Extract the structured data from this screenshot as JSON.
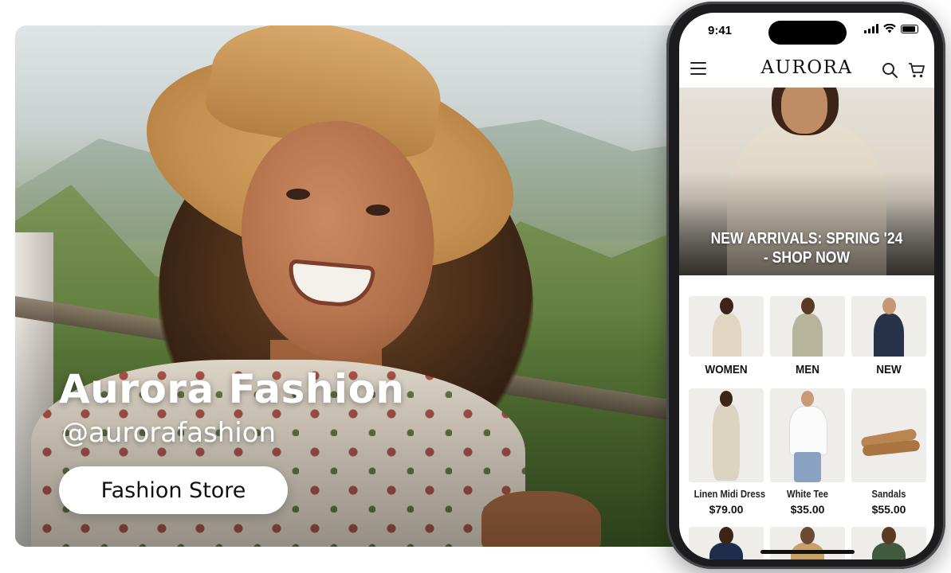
{
  "hero": {
    "title": "Aurora Fashion",
    "handle": "@aurorafashion",
    "category": "Fashion Store"
  },
  "phone": {
    "status_time": "9:41",
    "app_logo": "AURORA",
    "banner_text": "NEW ARRIVALS: SPRING '24 - SHOP NOW",
    "icons": {
      "menu": "hamburger-menu-icon",
      "search": "search-icon",
      "cart": "shopping-cart-icon"
    },
    "categories": [
      {
        "label": "WOMEN"
      },
      {
        "label": "MEN"
      },
      {
        "label": "NEW"
      }
    ],
    "products": [
      {
        "name": "Linen Midi Dress",
        "price": "$79.00"
      },
      {
        "name": "White Tee",
        "price": "$35.00"
      },
      {
        "name": "Sandals",
        "price": "$55.00"
      }
    ]
  },
  "colors": {
    "accent": "#111111",
    "card_bg": "#efedea",
    "pill_bg": "#ffffff"
  }
}
